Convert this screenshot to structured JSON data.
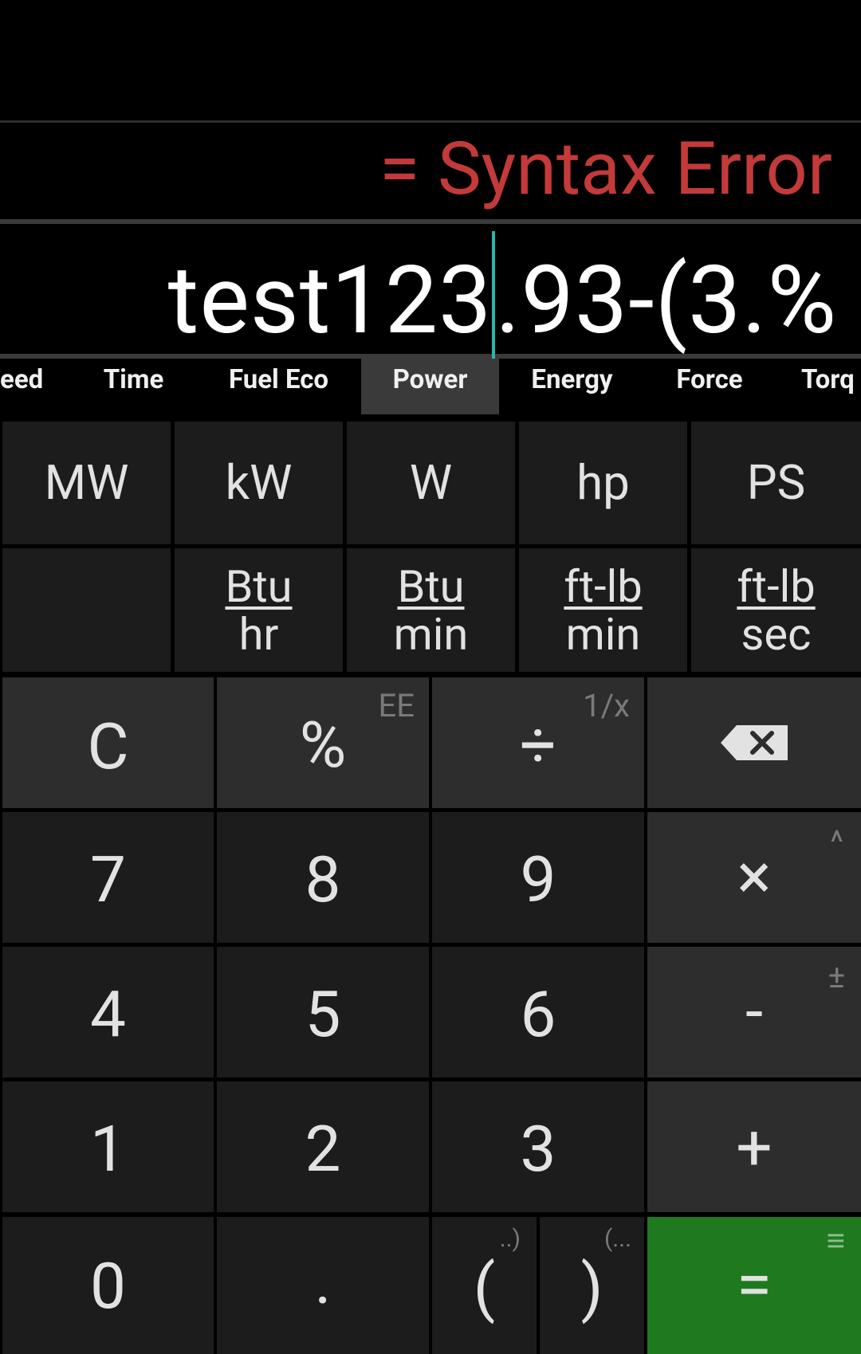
{
  "display": {
    "result": "= Syntax Error",
    "expression_before_caret": "test123",
    "expression_after_caret": ".93-(3.%"
  },
  "colors": {
    "error_red": "#c33a3a",
    "caret_teal": "#2db5ad",
    "equals_green": "#1f7a1f"
  },
  "tabs": [
    {
      "label": "eed"
    },
    {
      "label": "Time"
    },
    {
      "label": "Fuel Eco"
    },
    {
      "label": "Power",
      "active": true
    },
    {
      "label": "Energy"
    },
    {
      "label": "Force"
    },
    {
      "label": "Torq"
    }
  ],
  "units_row1": [
    "MW",
    "kW",
    "W",
    "hp",
    "PS"
  ],
  "units_row2": [
    {
      "num": "Btu",
      "den": "hr"
    },
    {
      "num": "Btu",
      "den": "min"
    },
    {
      "num": "ft-lb",
      "den": "min"
    },
    {
      "num": "ft-lb",
      "den": "sec"
    }
  ],
  "keypad": {
    "clear": "C",
    "percent": "%",
    "percent_alt": "EE",
    "divide": "÷",
    "divide_alt": "1/x",
    "multiply": "×",
    "multiply_alt": "^",
    "minus": "-",
    "minus_alt": "±",
    "plus": "+",
    "digits": [
      "0",
      "1",
      "2",
      "3",
      "4",
      "5",
      "6",
      "7",
      "8",
      "9"
    ],
    "dot": ".",
    "open_paren": "(",
    "open_paren_alt": "..)",
    "close_paren": ")",
    "close_paren_alt": "(...",
    "equals": "=",
    "equals_alt": "≡"
  }
}
